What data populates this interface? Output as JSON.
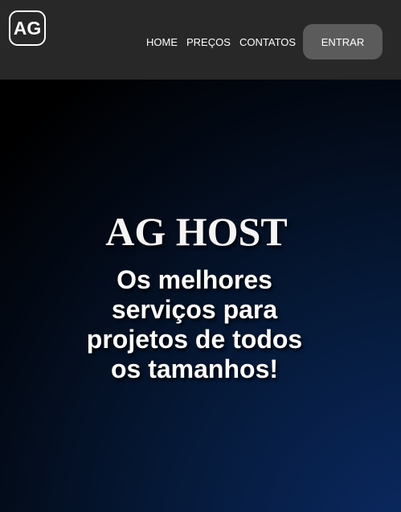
{
  "header": {
    "logo_text": "AG",
    "nav": {
      "home": "HOME",
      "precos": "PREÇOS",
      "contatos": "CONTATOS"
    },
    "login_button": "ENTRAR"
  },
  "hero": {
    "title": "AG HOST",
    "subtitle": "Os melhores serviços para projetos de todos os tamanhos!"
  },
  "colors": {
    "header_bg": "#282828",
    "button_bg": "#5b5b5b",
    "hero_gradient_edge": "#0b2a63",
    "text": "#ffffff"
  }
}
